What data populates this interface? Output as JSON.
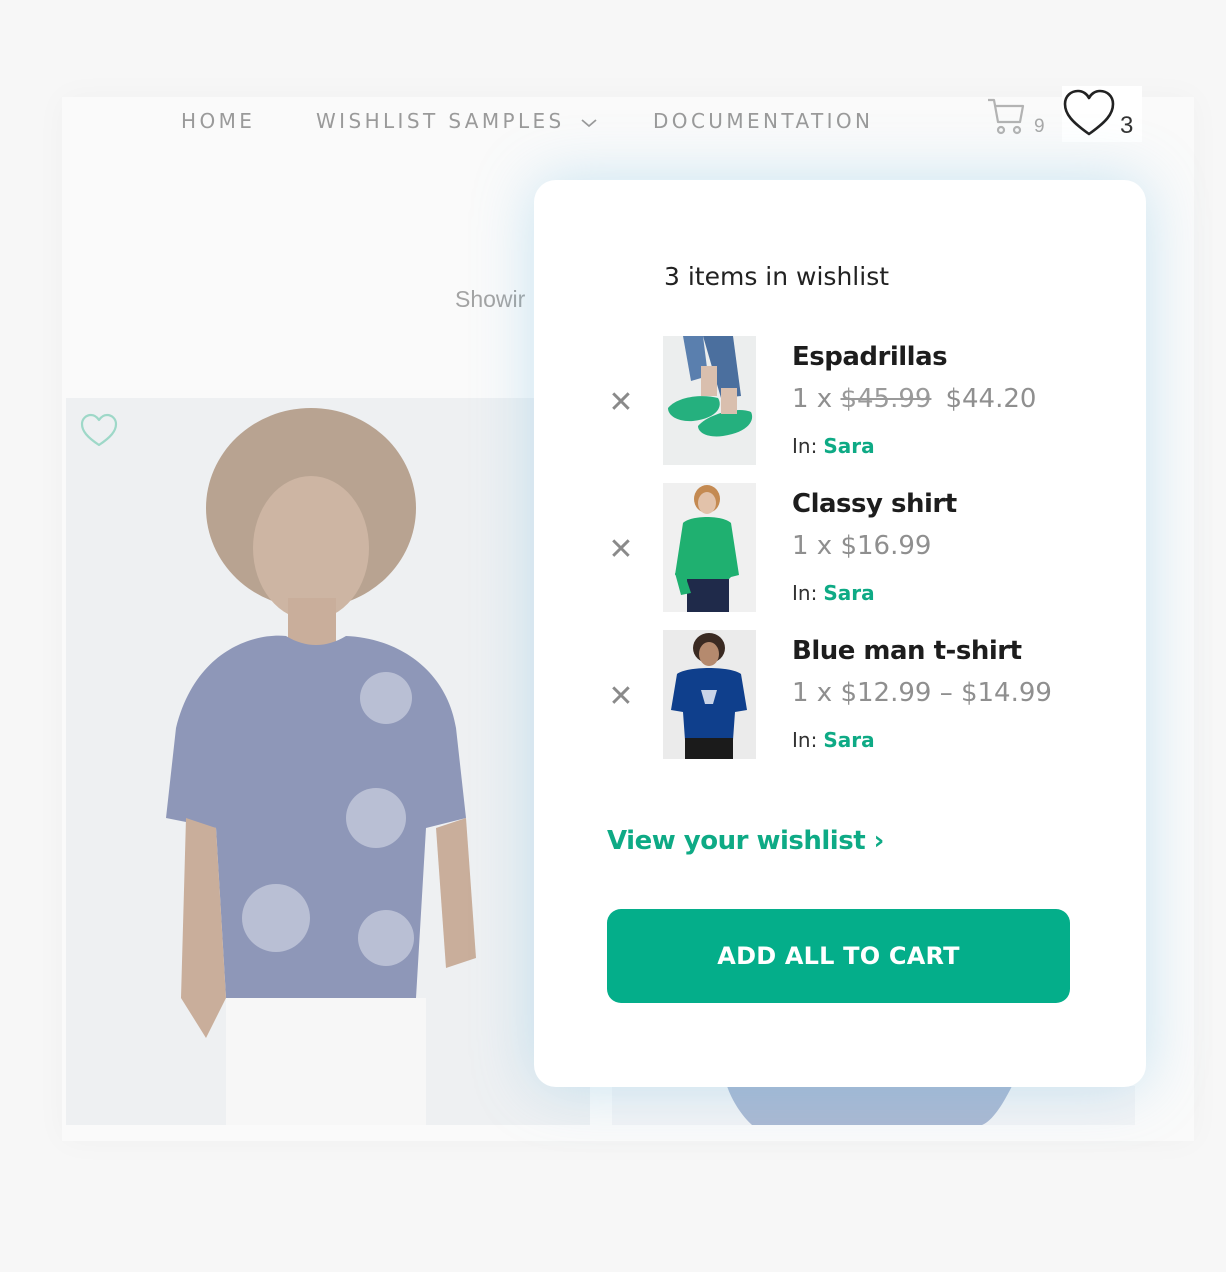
{
  "nav": {
    "home": "HOME",
    "samples": "WISHLIST SAMPLES",
    "documentation": "DOCUMENTATION",
    "cart_count": "9",
    "wishlist_count": "3"
  },
  "shop": {
    "showing_text": "Showir"
  },
  "popup": {
    "title": "3 items in wishlist",
    "items": [
      {
        "name": "Espadrillas",
        "qty_prefix": "1 x ",
        "old_price": "$45.99",
        "price": "$44.20",
        "in_label": "In:",
        "list": "Sara"
      },
      {
        "name": "Classy shirt",
        "qty_prefix": "1 x ",
        "old_price": "",
        "price": "$16.99",
        "in_label": "In:",
        "list": "Sara"
      },
      {
        "name": "Blue man t-shirt",
        "qty_prefix": "1 x ",
        "old_price": "",
        "price": "$12.99 – $14.99",
        "in_label": "In:",
        "list": "Sara"
      }
    ],
    "remove_symbol": "✕",
    "view_link": "View your wishlist ›",
    "add_all_button": "ADD ALL TO CART"
  },
  "colors": {
    "accent": "#04ae8a",
    "accent_text": "#0eaa85"
  }
}
